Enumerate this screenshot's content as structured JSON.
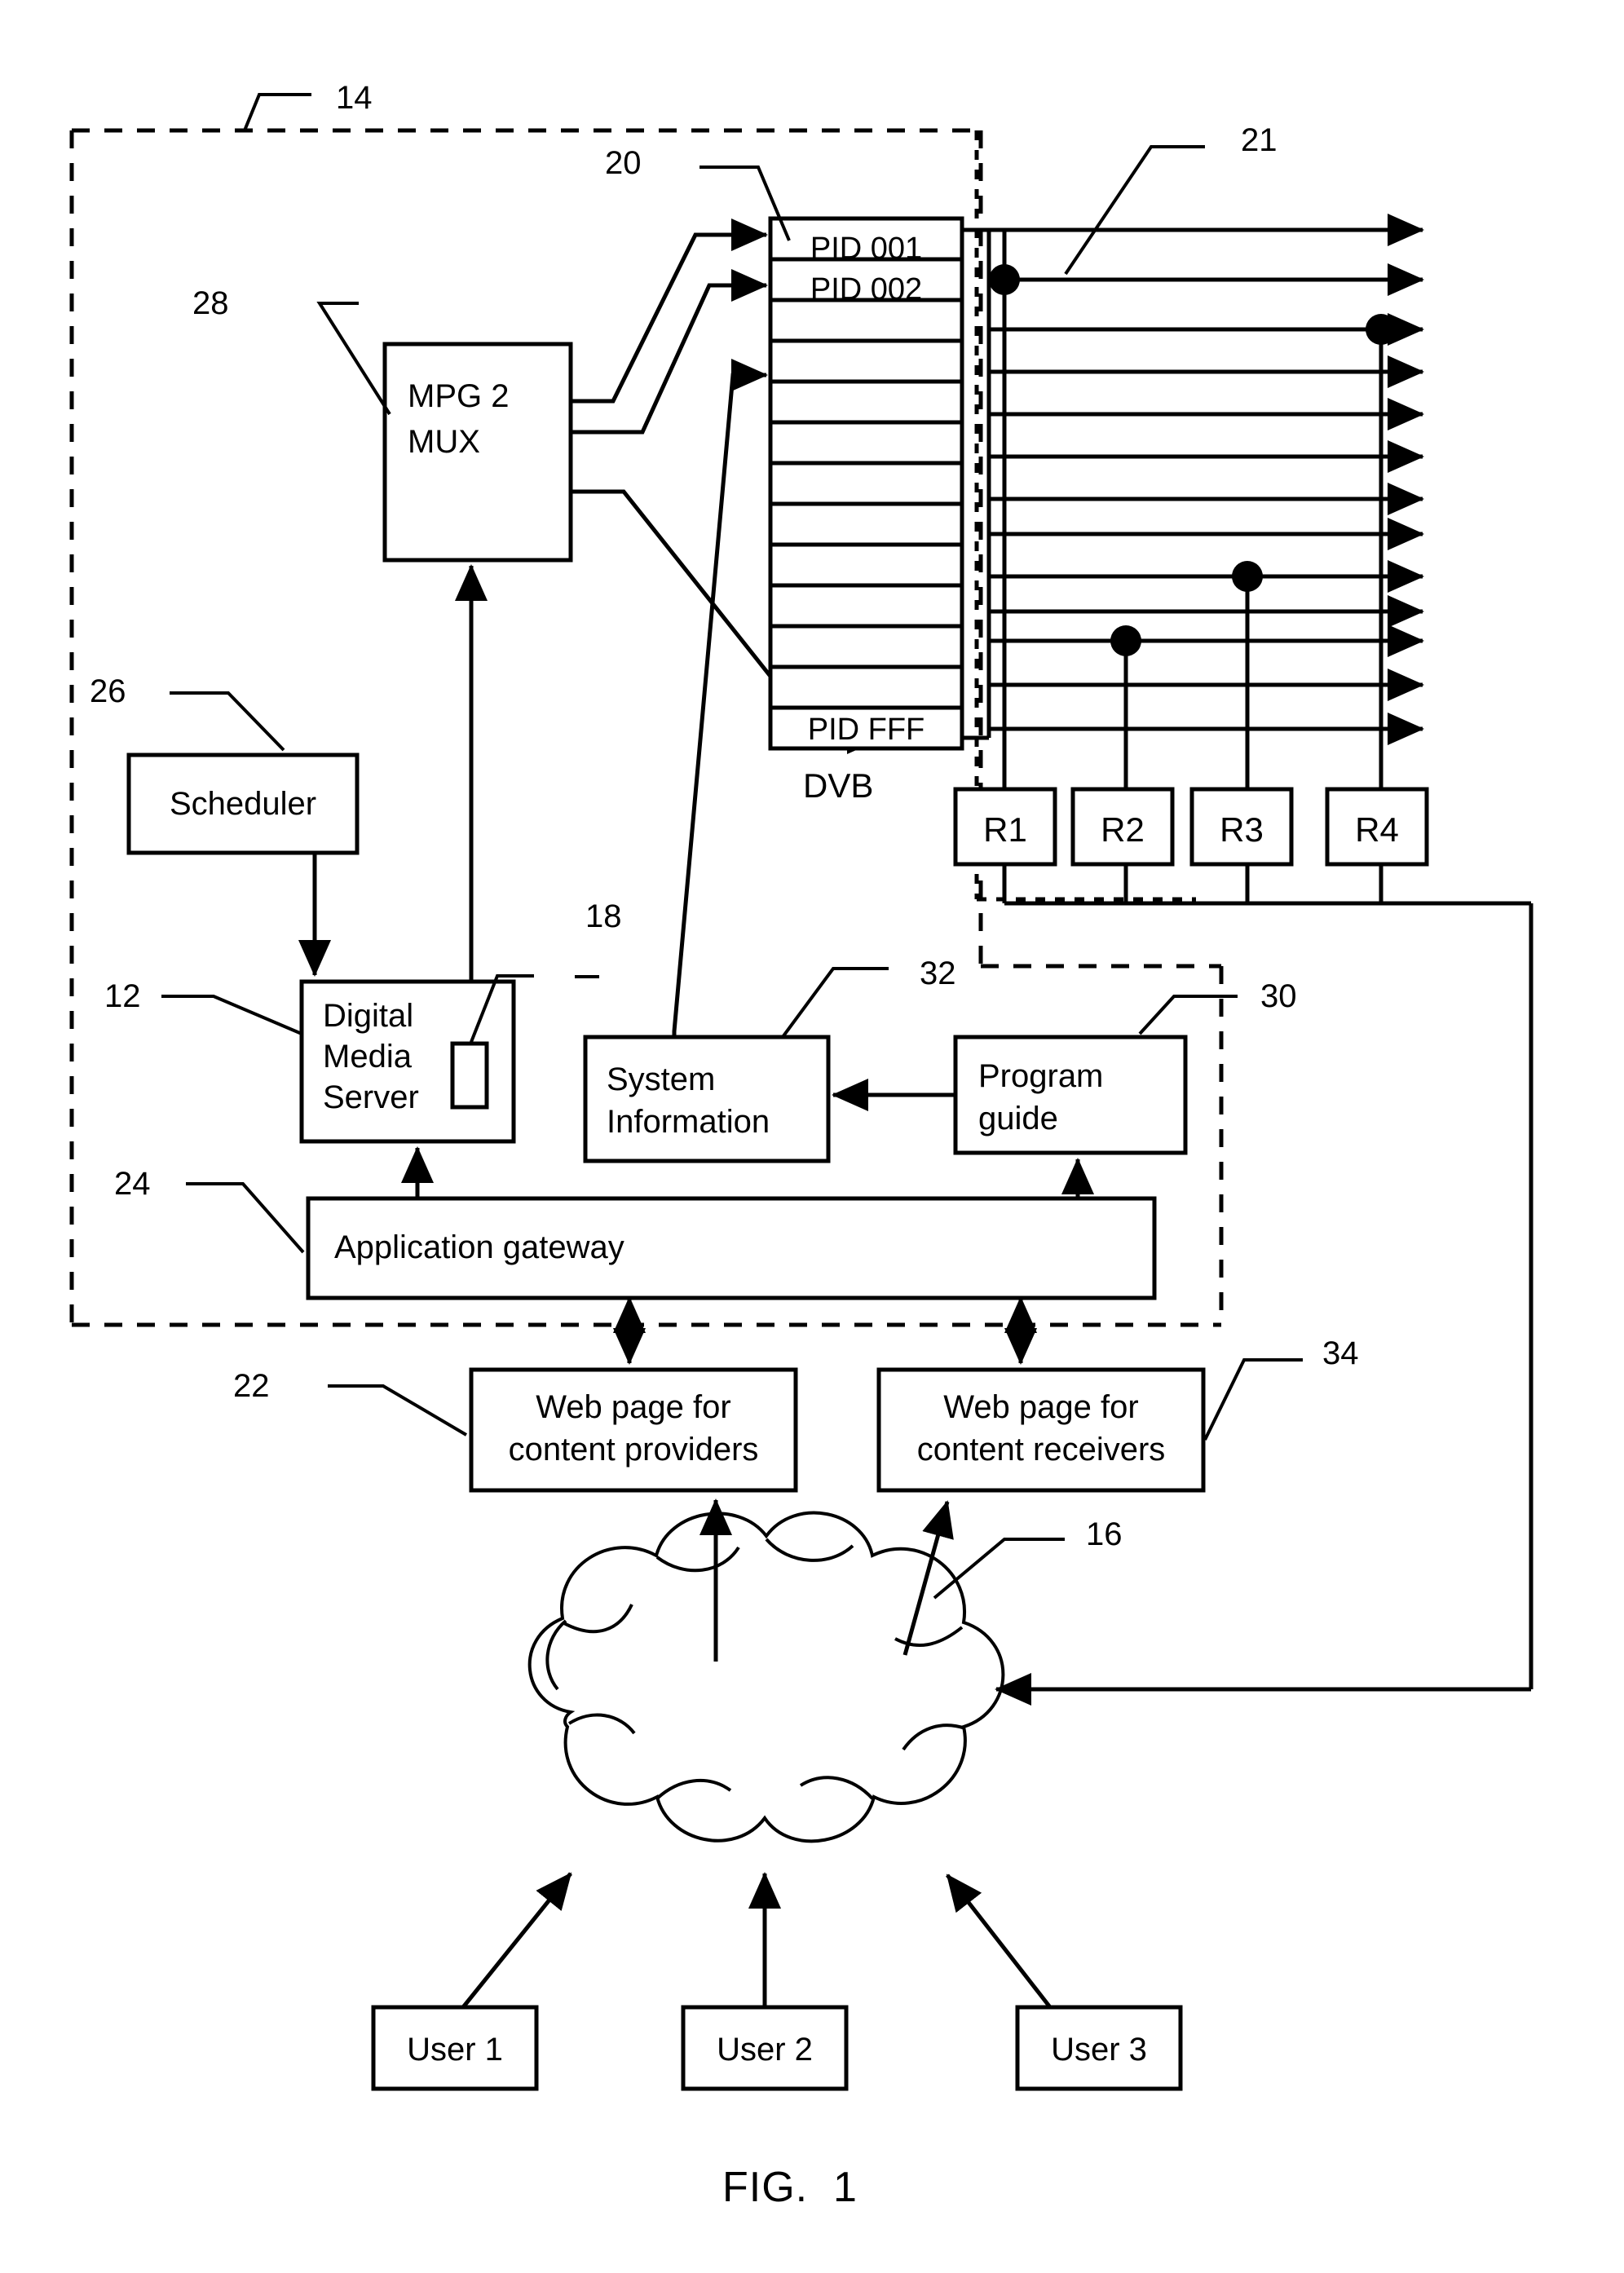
{
  "figure": {
    "caption": "FIG.  1",
    "type": "patent-block-diagram"
  },
  "reference_numerals": [
    {
      "id": "ref-14",
      "label": "14"
    },
    {
      "id": "ref-20",
      "label": "20"
    },
    {
      "id": "ref-21",
      "label": "21"
    },
    {
      "id": "ref-28",
      "label": "28"
    },
    {
      "id": "ref-26",
      "label": "26"
    },
    {
      "id": "ref-12",
      "label": "12"
    },
    {
      "id": "ref-18",
      "label": "18"
    },
    {
      "id": "ref-32",
      "label": "32"
    },
    {
      "id": "ref-30",
      "label": "30"
    },
    {
      "id": "ref-24",
      "label": "24"
    },
    {
      "id": "ref-22",
      "label": "22"
    },
    {
      "id": "ref-34",
      "label": "34"
    },
    {
      "id": "ref-16",
      "label": "16"
    }
  ],
  "blocks": {
    "mux": {
      "line1": "MPG 2",
      "line2": "MUX"
    },
    "scheduler": {
      "label": "Scheduler"
    },
    "digital_media_server": {
      "line1": "Digital",
      "line2": "Media",
      "line3": "Server"
    },
    "system_information": {
      "line1": "System",
      "line2": "Information"
    },
    "program_guide": {
      "line1": "Program",
      "line2": "guide"
    },
    "application_gateway": {
      "label": "Application gateway"
    },
    "web_page_providers": {
      "line1": "Web page for",
      "line2": "content providers"
    },
    "web_page_receivers": {
      "line1": "Web page for",
      "line2": "content receivers"
    },
    "dvb": {
      "label": "DVB"
    }
  },
  "pid_stack": {
    "rows": [
      {
        "label": "PID 001"
      },
      {
        "label": "PID 002"
      },
      {
        "label": ""
      },
      {
        "label": ""
      },
      {
        "label": ""
      },
      {
        "label": ""
      },
      {
        "label": ""
      },
      {
        "label": ""
      },
      {
        "label": ""
      },
      {
        "label": ""
      },
      {
        "label": ""
      },
      {
        "label": ""
      },
      {
        "label": "PID FFF"
      }
    ]
  },
  "receivers": [
    {
      "label": "R1"
    },
    {
      "label": "R2"
    },
    {
      "label": "R3"
    },
    {
      "label": "R4"
    }
  ],
  "users": [
    {
      "label": "User 1"
    },
    {
      "label": "User 2"
    },
    {
      "label": "User 3"
    }
  ],
  "network_cloud": {
    "name": "network-cloud"
  },
  "colors": {
    "ink": "#000000",
    "paper": "#ffffff"
  }
}
